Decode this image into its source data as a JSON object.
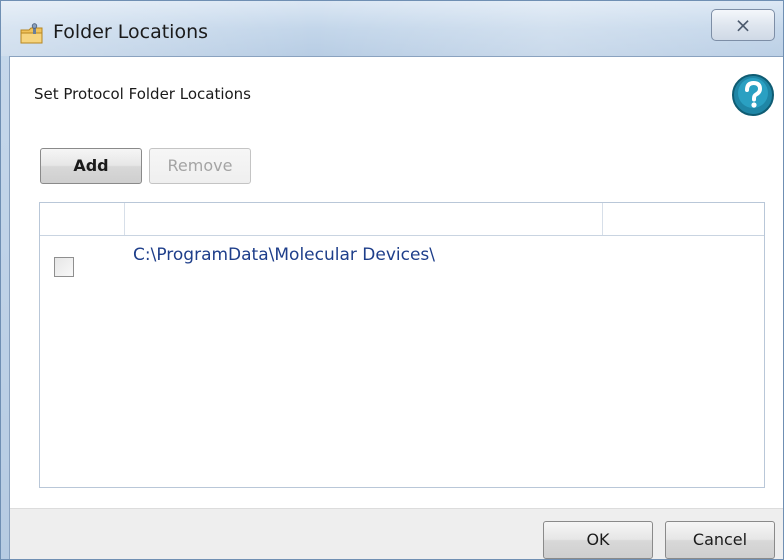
{
  "window": {
    "title": "Folder Locations",
    "close_glyph": "⨯"
  },
  "icons": {
    "title": "folder-settings-icon",
    "help": "help-icon",
    "close": "close-icon"
  },
  "colors": {
    "title_bar": "#c3d6ea",
    "link_text": "#1e3e8a",
    "help_icon": "#1f86a6"
  },
  "dialog": {
    "heading": "Set Protocol Folder Locations",
    "add_label": "Add",
    "remove_label": "Remove"
  },
  "folders": {
    "rows": [
      {
        "checked": false,
        "path": "C:\\ProgramData\\Molecular Devices\\"
      }
    ]
  },
  "footer": {
    "ok_label": "OK",
    "cancel_label": "Cancel"
  }
}
